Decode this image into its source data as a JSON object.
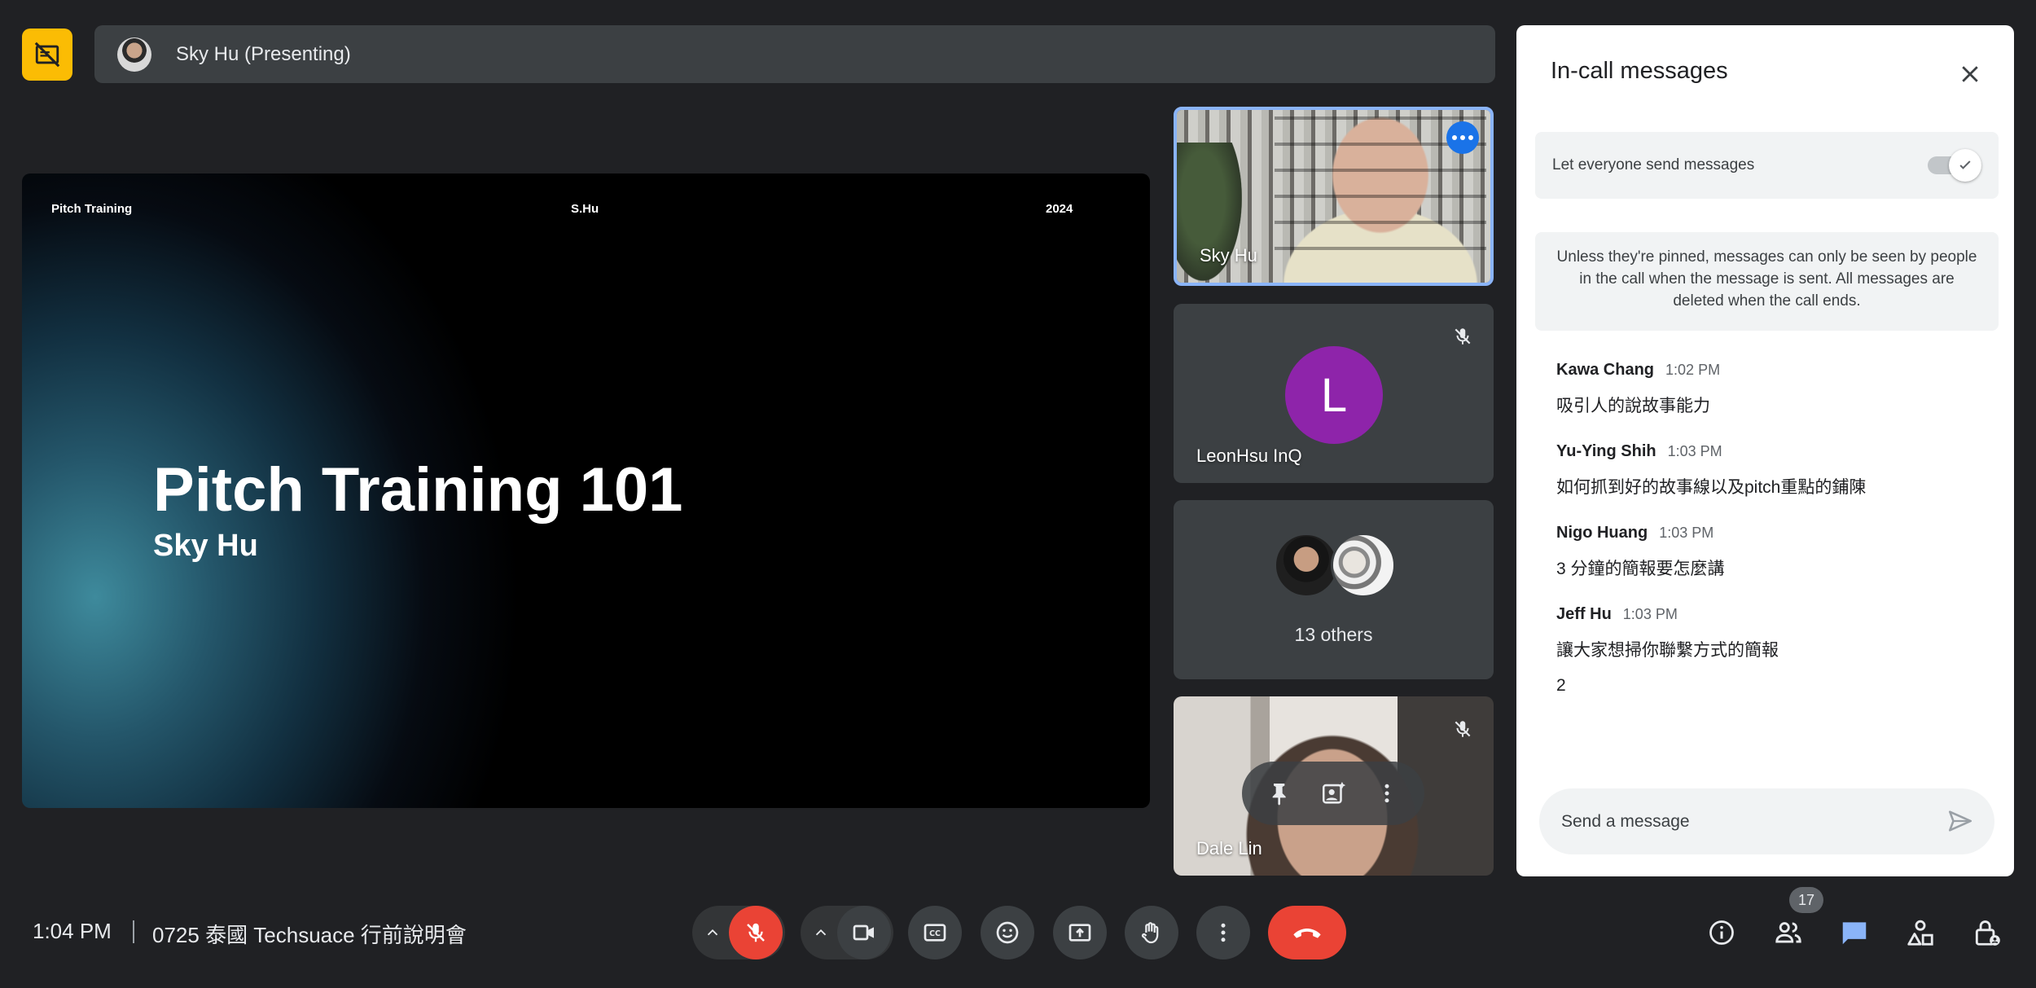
{
  "header": {
    "presenter_label": "Sky Hu (Presenting)"
  },
  "slide": {
    "header_left": "Pitch Training",
    "header_center": "S.Hu",
    "header_right": "2024",
    "title": "Pitch Training 101",
    "subtitle": "Sky Hu"
  },
  "tiles": [
    {
      "name": "Sky Hu",
      "muted": false,
      "pinned_spotlight": true
    },
    {
      "name": "LeonHsu InQ",
      "avatar_letter": "L",
      "avatar_color": "#8e24aa",
      "muted": true
    },
    {
      "others_label": "13 others"
    },
    {
      "name": "Dale Lin",
      "muted": true
    }
  ],
  "chat": {
    "title": "In-call messages",
    "toggle_label": "Let everyone send messages",
    "toggle_on": true,
    "notice": "Unless they're pinned, messages can only be seen by people in the call when the message is sent. All messages are deleted when the call ends.",
    "messages": [
      {
        "sender": "Kawa Chang",
        "time": "1:02 PM",
        "lines": [
          "吸引人的說故事能力"
        ]
      },
      {
        "sender": "Yu-Ying Shih",
        "time": "1:03 PM",
        "lines": [
          "如何抓到好的故事線以及pitch重點的鋪陳"
        ]
      },
      {
        "sender": "Nigo Huang",
        "time": "1:03 PM",
        "lines": [
          "3 分鐘的簡報要怎麼講"
        ]
      },
      {
        "sender": "Jeff Hu",
        "time": "1:03 PM",
        "lines": [
          "讓大家想掃你聯繫方式的簡報",
          "2"
        ]
      }
    ],
    "input_placeholder": "Send a message"
  },
  "footer": {
    "time": "1:04 PM",
    "meeting_title": "0725 泰國 Techsuace 行前說明會",
    "participant_count": "17"
  },
  "colors": {
    "background": "#202124",
    "tile": "#3c4043",
    "accent_blue": "#8ab4f8",
    "danger_red": "#ea4335",
    "brand_yellow": "#fbbc04"
  },
  "icons": [
    "present-stop-icon",
    "more-options-icon",
    "mic-off-icon",
    "camera-icon",
    "captions-icon",
    "emoji-icon",
    "present-icon",
    "raise-hand-icon",
    "end-call-icon",
    "info-icon",
    "people-icon",
    "chat-icon",
    "activities-icon",
    "host-controls-icon",
    "pin-icon",
    "background-effects-icon",
    "close-icon",
    "send-icon",
    "check-icon"
  ]
}
